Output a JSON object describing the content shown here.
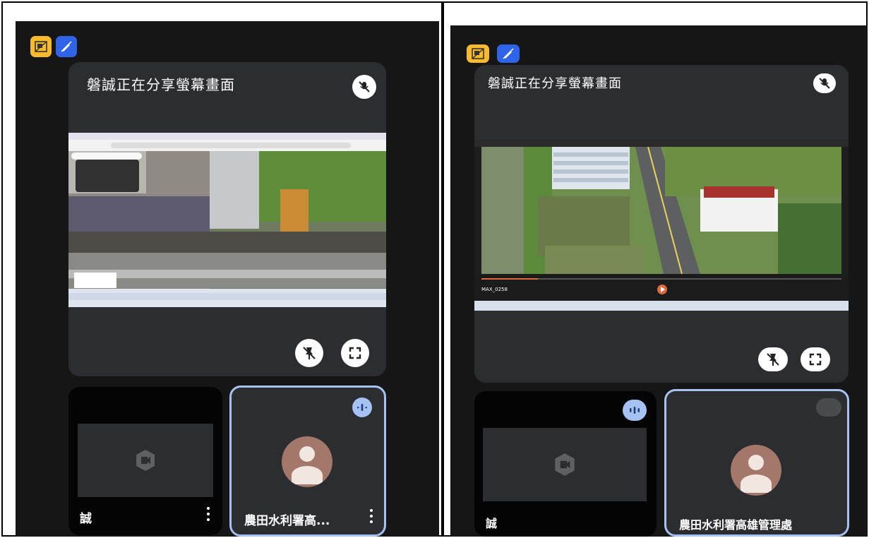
{
  "left_panel": {
    "share_title": "磐誠正在分享螢幕畫面",
    "participants": [
      {
        "name": "誠",
        "camera": "off"
      },
      {
        "name": "農田水利署高...",
        "speaking": true
      }
    ],
    "icons": [
      "layout-icon",
      "pen-icon",
      "mic-off-icon",
      "unpin-icon",
      "fullscreen-icon",
      "camera-off-icon",
      "more-icon",
      "avatar-icon",
      "speaking-icon"
    ]
  },
  "right_panel": {
    "share_title": "磐誠正在分享螢幕畫面",
    "video_filename": "MAX_0258",
    "participants": [
      {
        "name": "誠",
        "camera": "off",
        "speaking": true
      },
      {
        "name": "農田水利署高雄管理處"
      }
    ],
    "icons": [
      "layout-icon",
      "pen-icon",
      "mic-off-icon",
      "unpin-icon",
      "fullscreen-icon",
      "camera-off-icon",
      "avatar-icon",
      "speaking-icon"
    ]
  },
  "colors": {
    "background": "#161616",
    "card": "#2c2d30",
    "active_border": "#a6c2f3",
    "badge_yellow": "#f9bb2d",
    "badge_blue": "#2f64e8",
    "avatar": "#a3776a"
  }
}
